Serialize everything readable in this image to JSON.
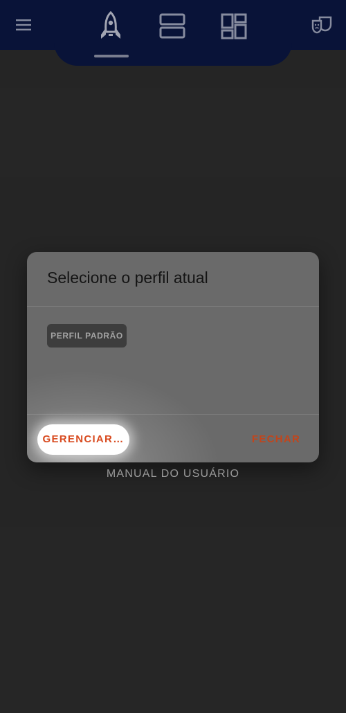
{
  "topbar": {
    "icons": [
      "menu-icon",
      "rocket-icon",
      "view-rows-icon",
      "dashboard-icon",
      "theater-masks-icon"
    ],
    "active_tab": "rocket-icon",
    "background_color": "#0b1640"
  },
  "page": {
    "manual_link": "MANUAL DO USUÁRIO"
  },
  "dialog": {
    "title": "Selecione o perfil atual",
    "profiles": [
      "PERFIL PADRÃO"
    ],
    "manage_button": "GERENCIAR…",
    "close_button": "FECHAR",
    "accent_color": "#d84a1f"
  }
}
